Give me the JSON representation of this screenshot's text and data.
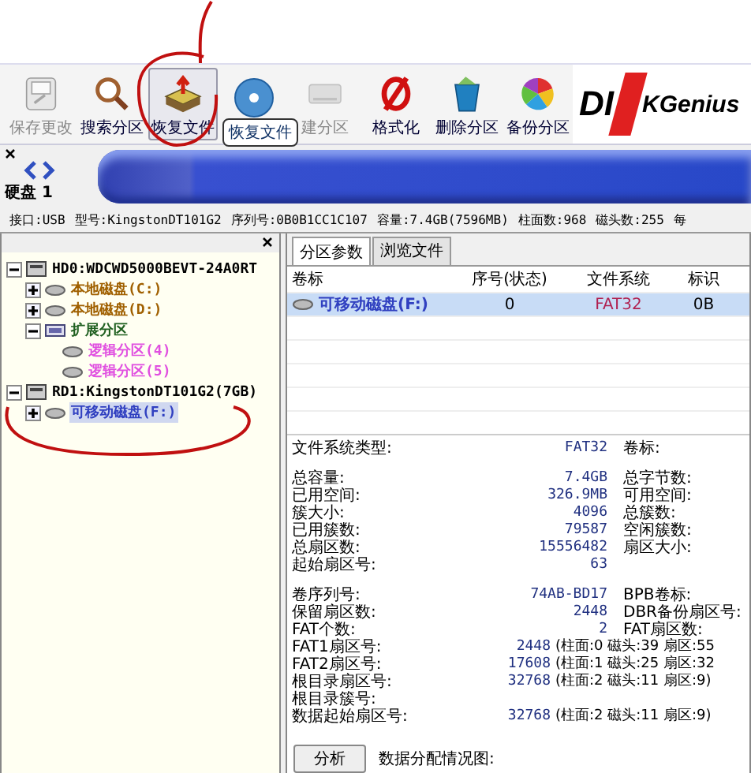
{
  "toolbar": {
    "buttons": [
      {
        "label": "保存更改",
        "disabled": true,
        "hovered": false
      },
      {
        "label": "搜索分区",
        "disabled": false,
        "hovered": false
      },
      {
        "label": "恢复文件",
        "disabled": false,
        "hovered": true
      },
      {
        "disabled": false,
        "hovered": false
      },
      {
        "label": "建分区",
        "disabled": true,
        "hovered": false
      },
      {
        "label": "格式化",
        "disabled": false,
        "hovered": false
      },
      {
        "label": "删除分区",
        "disabled": false,
        "hovered": false
      },
      {
        "label": "备份分区",
        "disabled": false,
        "hovered": false
      }
    ],
    "tooltip": "恢复文件",
    "logo": {
      "left": "DI",
      "right": "KGenius"
    }
  },
  "disk_bar": {
    "label": "硬盘 1"
  },
  "disk_info": [
    "接口:USB",
    "型号:KingstonDT101G2",
    "序列号:0B0B1CC1C107",
    "容量:7.4GB(7596MB)",
    "柱面数:968",
    "磁头数:255",
    "每"
  ],
  "tree": [
    {
      "label": "HD0:WDCWD5000BEVT-24A0RT",
      "kind": "disk",
      "expanded": true,
      "selected": false,
      "children": [
        {
          "label": "本地磁盘(C:)",
          "kind": "primary",
          "expanded": false,
          "selected": false
        },
        {
          "label": "本地磁盘(D:)",
          "kind": "primary",
          "expanded": false,
          "selected": false
        },
        {
          "label": "扩展分区",
          "kind": "extended",
          "expanded": true,
          "selected": false,
          "children": [
            {
              "label": "逻辑分区(4)",
              "kind": "logical",
              "selected": false
            },
            {
              "label": "逻辑分区(5)",
              "kind": "logical",
              "selected": false
            }
          ]
        }
      ]
    },
    {
      "label": "RD1:KingstonDT101G2(7GB)",
      "kind": "disk",
      "expanded": true,
      "selected": false,
      "children": [
        {
          "label": "可移动磁盘(F:)",
          "kind": "removable",
          "expanded": false,
          "selected": true
        }
      ]
    }
  ],
  "tabs": [
    {
      "label": "分区参数",
      "selected": true
    },
    {
      "label": "浏览文件",
      "selected": false
    }
  ],
  "table": {
    "columns": [
      "卷标",
      "序号(状态)",
      "文件系统",
      "标识"
    ],
    "rows": [
      {
        "cells": [
          "可移动磁盘(F:)",
          "0",
          "FAT32",
          "0B"
        ],
        "selected": true
      }
    ]
  },
  "details": {
    "groups": [
      [
        {
          "label": "文件系统类型:",
          "value": "FAT32",
          "label2": "卷标:"
        }
      ],
      [
        {
          "label": "总容量:",
          "value": "7.4GB",
          "label2": "总字节数:"
        },
        {
          "label": "已用空间:",
          "value": "326.9MB",
          "label2": "可用空间:"
        },
        {
          "label": "簇大小:",
          "value": "4096",
          "label2": "总簇数:"
        },
        {
          "label": "已用簇数:",
          "value": "79587",
          "label2": "空闲簇数:"
        },
        {
          "label": "总扇区数:",
          "value": "15556482",
          "label2": "扇区大小:"
        },
        {
          "label": "起始扇区号:",
          "value": "63"
        }
      ],
      [
        {
          "label": "卷序列号:",
          "value": "74AB-BD17",
          "label2": "BPB卷标:"
        },
        {
          "label": "保留扇区数:",
          "value": "2448",
          "label2": "DBR备份扇区号:"
        },
        {
          "label": "FAT个数:",
          "value": "2",
          "label2": "FAT扇区数:"
        },
        {
          "label": "FAT1扇区号:",
          "value": "2448",
          "extra": "(柱面:0 磁头:39 扇区:55"
        },
        {
          "label": "FAT2扇区号:",
          "value": "17608",
          "extra": "(柱面:1 磁头:25 扇区:32"
        },
        {
          "label": "根目录扇区号:",
          "value": "32768",
          "extra": "(柱面:2 磁头:11 扇区:9)"
        },
        {
          "label": "根目录簇号:"
        },
        {
          "label": "数据起始扇区号:",
          "value": "32768",
          "extra": "(柱面:2 磁头:11 扇区:9)"
        }
      ]
    ]
  },
  "analyze_button": "分析",
  "allocation_label": "数据分配情况图:"
}
